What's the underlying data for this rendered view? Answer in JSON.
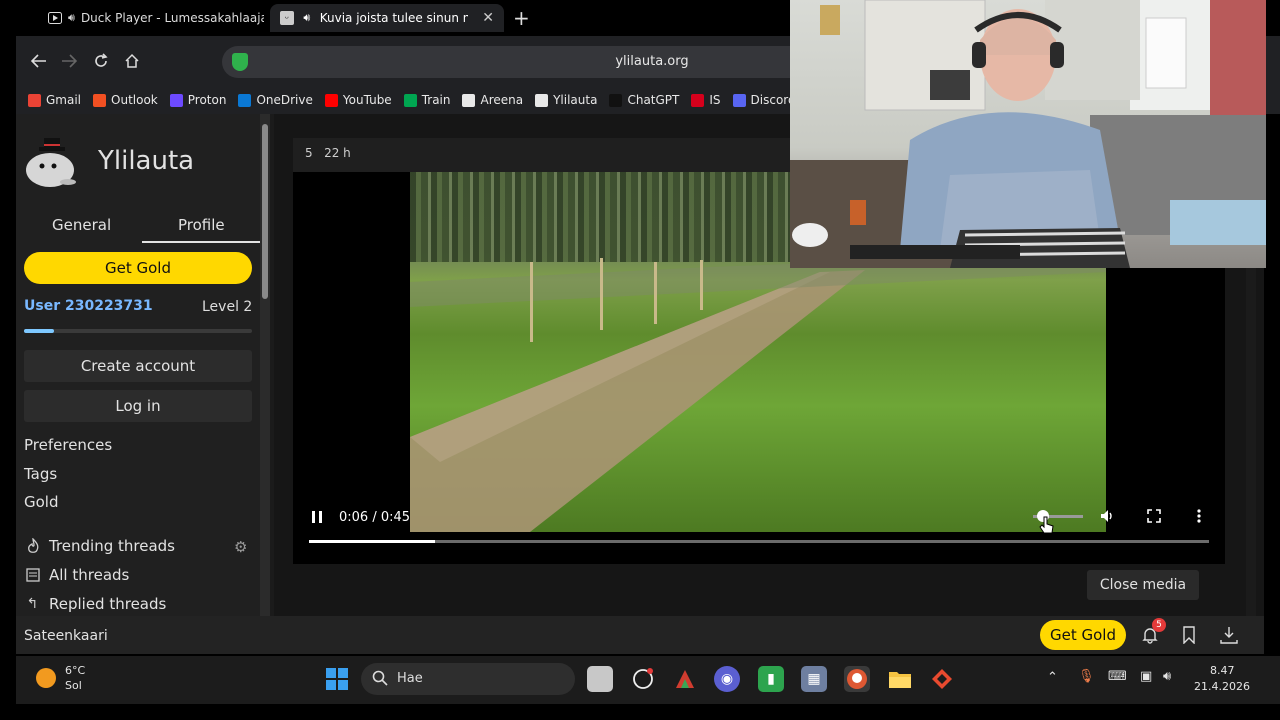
{
  "browser": {
    "tabs": [
      {
        "label": "Duck Player - Lumessakahlaajat",
        "active": false
      },
      {
        "label": "Kuvia joista tulee sinun nuoruus mieleen",
        "active": true
      }
    ],
    "new_tab_label": "+",
    "url": "ylilauta.org",
    "bookmarks": [
      {
        "label": "Gmail",
        "color": "#ea4335"
      },
      {
        "label": "Outlook",
        "color": "#f25022"
      },
      {
        "label": "Proton",
        "color": "#6d4aff"
      },
      {
        "label": "OneDrive",
        "color": "#0a78d4"
      },
      {
        "label": "YouTube",
        "color": "#ff0000"
      },
      {
        "label": "Train",
        "color": "#00a651"
      },
      {
        "label": "Areena",
        "color": "#e8e8e8"
      },
      {
        "label": "Ylilauta",
        "color": "#e8e8e8"
      },
      {
        "label": "ChatGPT",
        "color": "#111111"
      },
      {
        "label": "IS",
        "color": "#d6001c"
      },
      {
        "label": "Discord",
        "color": "#5865f2"
      }
    ]
  },
  "sidebar": {
    "site_title": "Ylilauta",
    "tabs": [
      "General",
      "Profile"
    ],
    "get_gold": "Get Gold",
    "user_name": "User 230223731",
    "user_level": "Level 2",
    "level_progress": 0.13,
    "create_account": "Create account",
    "log_in": "Log in",
    "links": [
      "Preferences",
      "Tags",
      "Gold"
    ],
    "thread_links": [
      "Trending threads",
      "All threads",
      "Replied threads"
    ]
  },
  "post": {
    "count": "5",
    "age": "22 h"
  },
  "video": {
    "time": "0:06 / 0:45",
    "progress": 0.14,
    "close_media": "Close media"
  },
  "page_bar": {
    "left_text": "Sateenkaari",
    "get_gold": "Get Gold",
    "notifications": "5"
  },
  "taskbar": {
    "weather_temp": "6°C",
    "weather_desc": "Sol",
    "search_placeholder": "Hae",
    "time": "8.47",
    "date": "21.4.2026"
  },
  "colors": {
    "gold": "#ffd800",
    "username": "#79b8ff",
    "badge": "#e43a3a"
  }
}
